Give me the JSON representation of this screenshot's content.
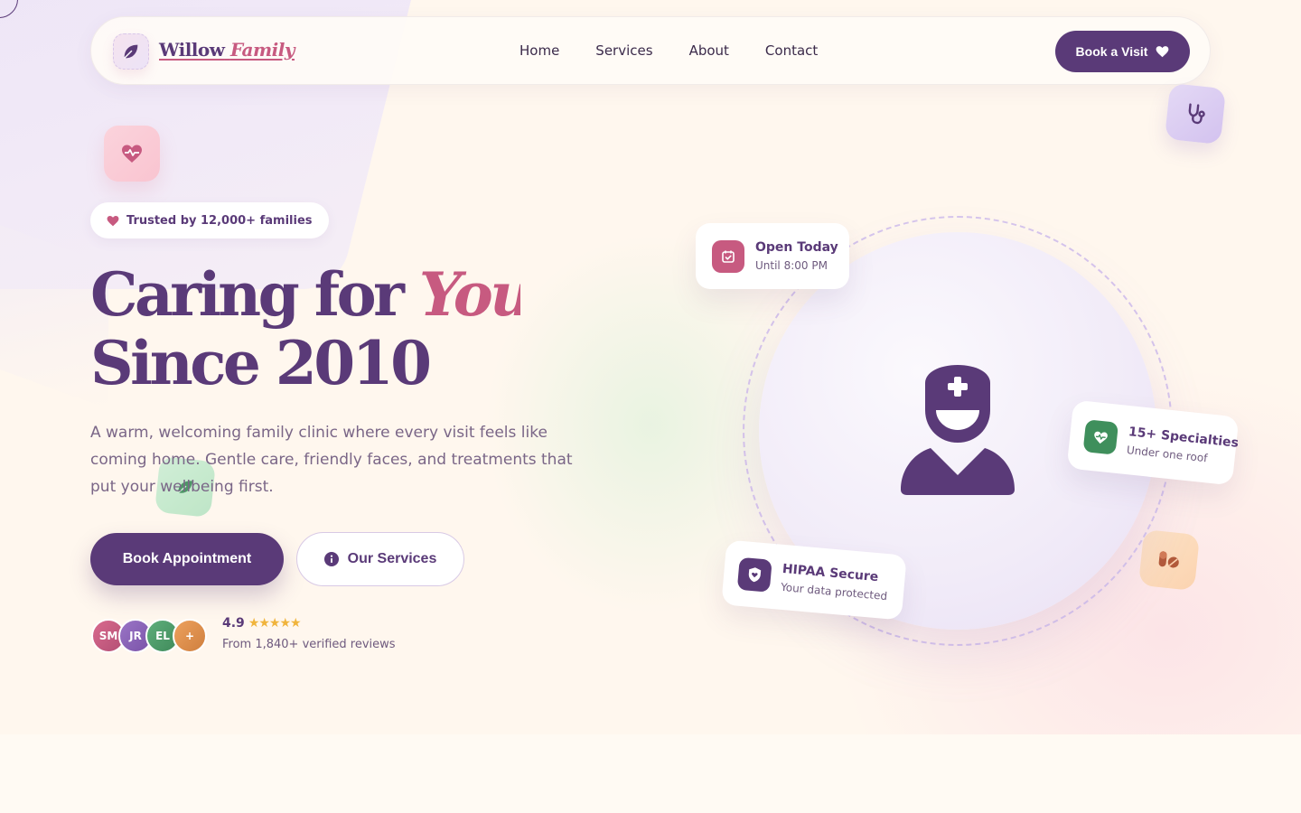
{
  "brand": {
    "name_part1": "Willow",
    "name_part2": "Family"
  },
  "nav": {
    "links": [
      "Home",
      "Services",
      "About",
      "Contact"
    ],
    "cta_label": "Book a Visit"
  },
  "hero": {
    "trust_badge": "Trusted by 12,000+ families",
    "headline_part1": "Caring for",
    "headline_accent": "You",
    "headline_line2": "Since 2010",
    "description": "A warm, welcoming family clinic where every visit feels like coming home. Gentle care, friendly faces, and treatments that put your wellbeing first.",
    "primary_cta": "Book Appointment",
    "secondary_cta": "Our Services"
  },
  "social_proof": {
    "avatars": [
      {
        "initials": "SM",
        "color": "#c75a80"
      },
      {
        "initials": "JR",
        "color": "#8a62b8"
      },
      {
        "initials": "EL",
        "color": "#4f9a6a"
      },
      {
        "initials": "+",
        "color": "#e0944f"
      }
    ],
    "rating": "4.9",
    "stars": "★★★★★",
    "reviews_text": "From 1,840+ verified reviews"
  },
  "cards": {
    "open": {
      "title": "Open Today",
      "subtitle": "Until 8:00 PM"
    },
    "specialties": {
      "title": "15+ Specialties",
      "subtitle": "Under one roof"
    },
    "hipaa": {
      "title": "HIPAA Secure",
      "subtitle": "Your data protected"
    }
  },
  "colors": {
    "primary": "#5a3a78",
    "accent": "#c75a80",
    "green": "#3f8f5c",
    "star": "#f0b43c"
  },
  "icons": [
    "leaf-icon",
    "heart-icon",
    "heartbeat-icon",
    "stethoscope-icon",
    "pills-icon",
    "info-icon",
    "calendar-icon",
    "shield-icon",
    "doctor-icon"
  ]
}
